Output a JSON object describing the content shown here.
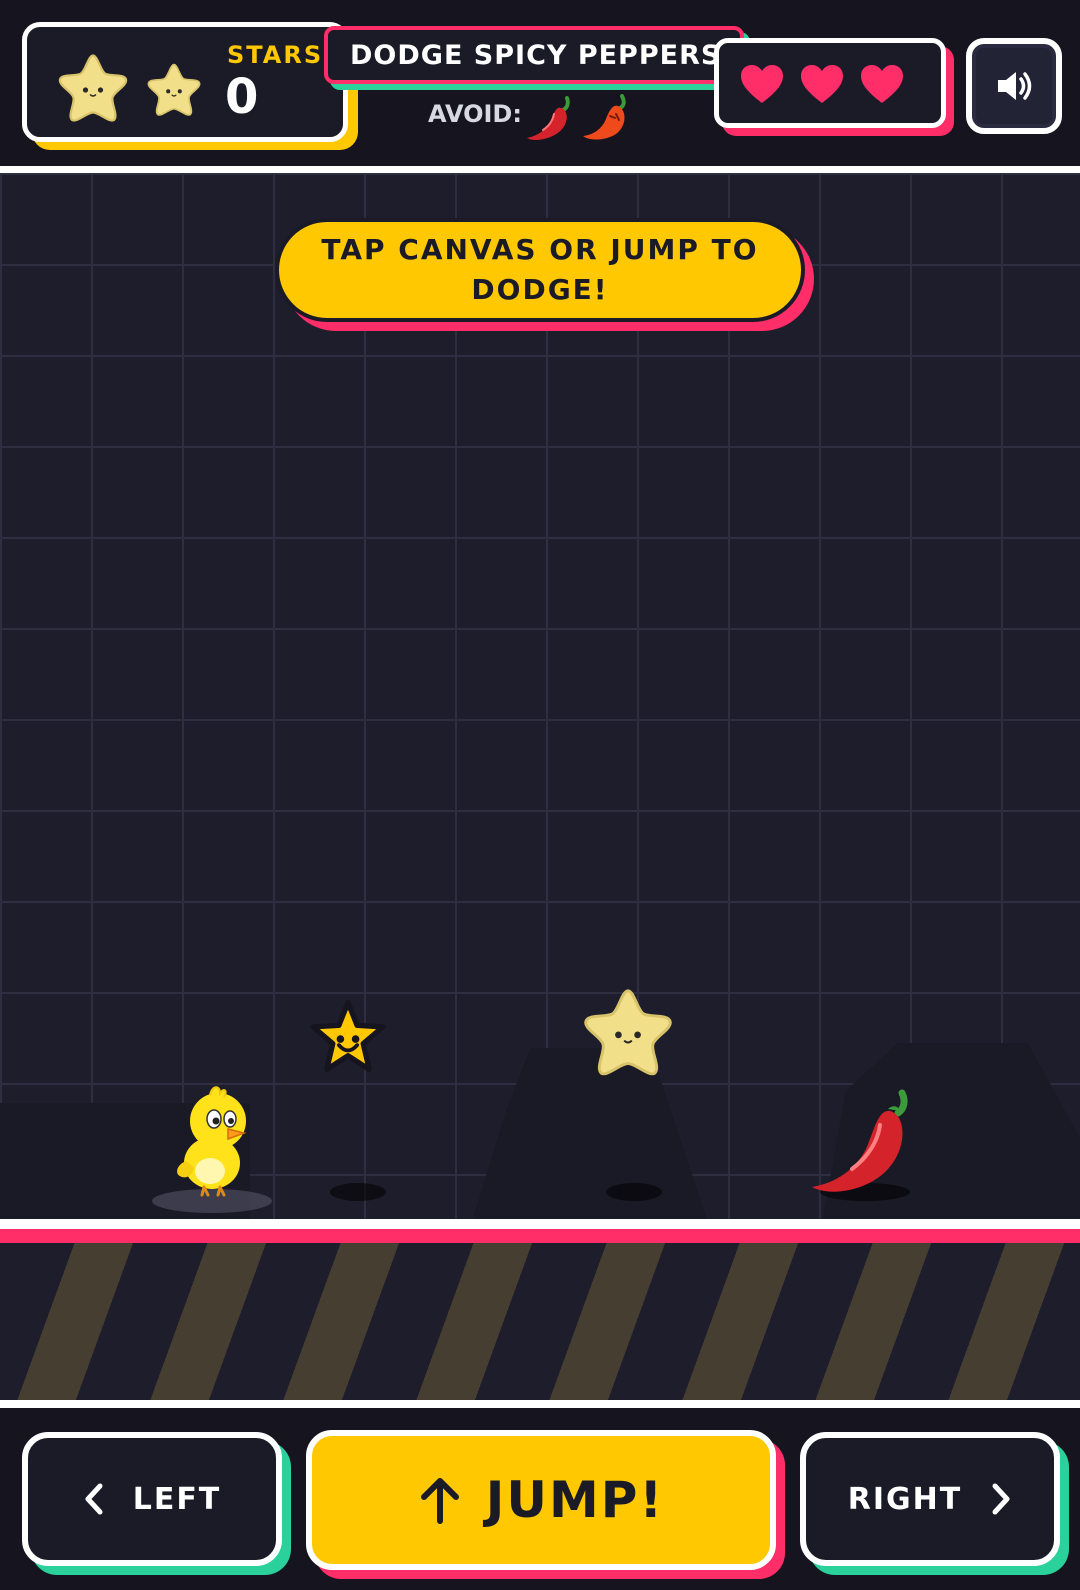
{
  "hud": {
    "stars_label": "STARS",
    "stars_count": "0",
    "title": "DODGE SPICY PEPPERS!",
    "avoid_label": "AVOID:",
    "avoid_icons": [
      "chili-pepper-icon",
      "angry-chili-pepper-icon"
    ],
    "lives": 3,
    "sound_icon": "speaker-icon"
  },
  "canvas": {
    "hint": "TAP CANVAS OR JUMP TO DODGE!",
    "sprites": [
      "chick-player",
      "star-token",
      "plush-star-collectible",
      "chili-pepper-obstacle"
    ]
  },
  "controls": {
    "left_label": "LEFT",
    "jump_label": "JUMP!",
    "right_label": "RIGHT"
  },
  "colors": {
    "background": "#15141f",
    "accent_yellow": "#ffc800",
    "accent_pink": "#ff2d68",
    "accent_green": "#2ad19b",
    "panel": "#1b1b28"
  }
}
